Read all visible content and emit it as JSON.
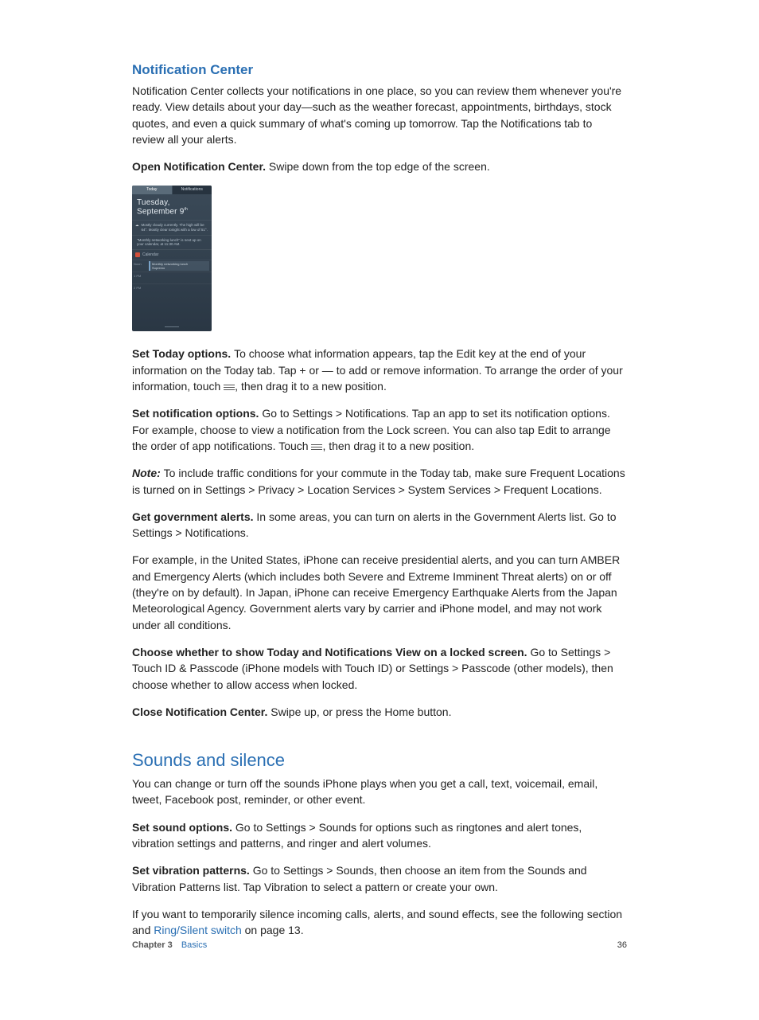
{
  "section1": {
    "title": "Notification Center",
    "intro": "Notification Center collects your notifications in one place, so you can review them whenever you're ready. View details about your day—such as the weather forecast, appointments, birthdays, stock quotes, and even a quick summary of what's coming up tomorrow. Tap the Notifications tab to review all your alerts.",
    "open_bold": "Open Notification Center. ",
    "open_rest": "Swipe down from the top edge of the screen.",
    "today_bold": "Set Today options. ",
    "today_rest_a": "To choose what information appears, tap the Edit key at the end of your information on the Today tab. Tap + or — to add or remove information. To arrange the order of your information, touch ",
    "today_rest_b": ", then drag it to a new position.",
    "notif_bold": "Set notification options. ",
    "notif_rest_a": "Go to Settings > Notifications. Tap an app to set its notification options. For example, choose to view a notification from the Lock screen. You can also tap Edit to arrange the order of app notifications. Touch ",
    "notif_rest_b": ", then drag it to a new position.",
    "note_label": "Note:  ",
    "note_text": "To include traffic conditions for your commute in the Today tab, make sure Frequent Locations is turned on in Settings > Privacy > Location Services > System Services > Frequent Locations.",
    "gov_bold": "Get government alerts. ",
    "gov_rest": "In some areas, you can turn on alerts in the Government Alerts list. Go to Settings > Notifications.",
    "gov_para2": "For example, in the United States, iPhone can receive presidential alerts, and you can turn AMBER and Emergency Alerts (which includes both Severe and Extreme Imminent Threat alerts) on or off (they're on by default). In Japan, iPhone can receive Emergency Earthquake Alerts from the Japan Meteorological Agency. Government alerts vary by carrier and iPhone model, and may not work under all conditions.",
    "lock_bold": "Choose whether to show Today and Notifications View on a locked screen. ",
    "lock_rest": "Go to Settings > Touch ID & Passcode (iPhone models with Touch ID) or Settings > Passcode (other models), then choose whether to allow access when locked.",
    "close_bold": "Close Notification Center. ",
    "close_rest": "Swipe up, or press the Home button."
  },
  "shot": {
    "tab_today": "Today",
    "tab_notifications": "Notifications",
    "date_line1": "Tuesday,",
    "date_line2": "September 9",
    "date_suffix": "th",
    "weather_icon": "☁",
    "weather_text": "Mostly cloudy currently. The high will be 64°. Mostly clear tonight with a low of 51°.",
    "quote_text": "\"Monthly networking lunch\" is next up on your calendar, at 11:30 AM.",
    "calendar_label": "Calendar",
    "row_noon": "Noon",
    "event_title": "Monthly networking lunch",
    "event_sub": "Supremo",
    "row_1pm": "1 PM",
    "row_2pm": "2 PM"
  },
  "section2": {
    "title": "Sounds and silence",
    "intro": "You can change or turn off the sounds iPhone plays when you get a call, text, voicemail, email, tweet, Facebook post, reminder, or other event.",
    "sound_bold": "Set sound options. ",
    "sound_rest": "Go to Settings > Sounds for options such as ringtones and alert tones, vibration settings and patterns, and ringer and alert volumes.",
    "vib_bold": "Set vibration patterns. ",
    "vib_rest": "Go to Settings > Sounds, then choose an item from the Sounds and Vibration Patterns list. Tap Vibration to select a pattern or create your own.",
    "silence_a": "If you want to temporarily silence incoming calls, alerts, and sound effects, see the following section and ",
    "silence_link": "Ring/Silent switch",
    "silence_b": " on page 13."
  },
  "footer": {
    "chapter_label": "Chapter 3",
    "chapter_name": "Basics",
    "page_no": "36"
  }
}
